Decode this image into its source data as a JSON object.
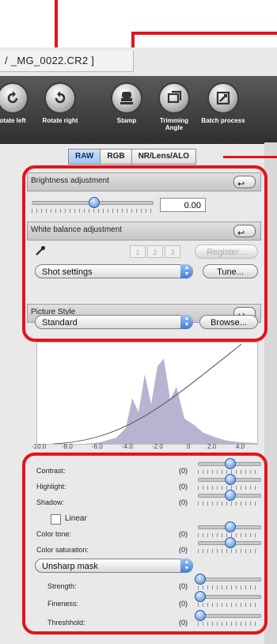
{
  "window": {
    "title": "/ _MG_0022.CR2 ]"
  },
  "toolbar": {
    "items": [
      {
        "label": "otate left",
        "icon": "rotate-left-icon"
      },
      {
        "label": "Rotate right",
        "icon": "rotate-right-icon"
      },
      {
        "label": "Stamp",
        "icon": "stamp-icon"
      },
      {
        "label": "Trimming Angle",
        "icon": "trimming-angle-icon"
      },
      {
        "label": "Batch process",
        "icon": "batch-process-icon"
      }
    ]
  },
  "tabs": [
    {
      "label": "RAW",
      "active": true
    },
    {
      "label": "RGB",
      "active": false
    },
    {
      "label": "NR/Lens/ALO",
      "active": false
    }
  ],
  "brightness": {
    "title": "Brightness adjustment",
    "value": "0.00",
    "level": 0.55
  },
  "white_balance": {
    "title": "White balance adjustment",
    "slots": [
      "1",
      "2",
      "3"
    ],
    "register_label": "Register...",
    "preset": "Shot settings",
    "tune_label": "Tune..."
  },
  "picture_style": {
    "title": "Picture Style",
    "value": "Standard",
    "browse_label": "Browse..."
  },
  "histogram": {
    "axis_labels": [
      "-10.0",
      "-8.0",
      "-6.0",
      "-4.0",
      "-2.0",
      "0",
      "2.0",
      "4.0"
    ]
  },
  "tone": {
    "rows": [
      {
        "label": "Contrast:",
        "value": "(0)",
        "level": 0.5
      },
      {
        "label": "Highlight:",
        "value": "(0)",
        "level": 0.5
      },
      {
        "label": "Shadow:",
        "value": "(0)",
        "level": 0.5
      }
    ],
    "linear_label": "Linear",
    "rows2": [
      {
        "label": "Color tone:",
        "value": "(0)",
        "level": 0.5
      },
      {
        "label": "Color saturation:",
        "value": "(0)",
        "level": 0.5
      }
    ],
    "sharpen_mode": "Unsharp mask",
    "rows3": [
      {
        "label": "Strength:",
        "value": "(0)",
        "level": 0.0
      },
      {
        "label": "Fineness:",
        "value": "(0)",
        "level": 0.0
      },
      {
        "label": "Threshhold:",
        "value": "(0)",
        "level": 0.0
      }
    ]
  },
  "colors": {
    "annotation_red": "#e3141b",
    "accent_blue": "#4b86d2"
  }
}
